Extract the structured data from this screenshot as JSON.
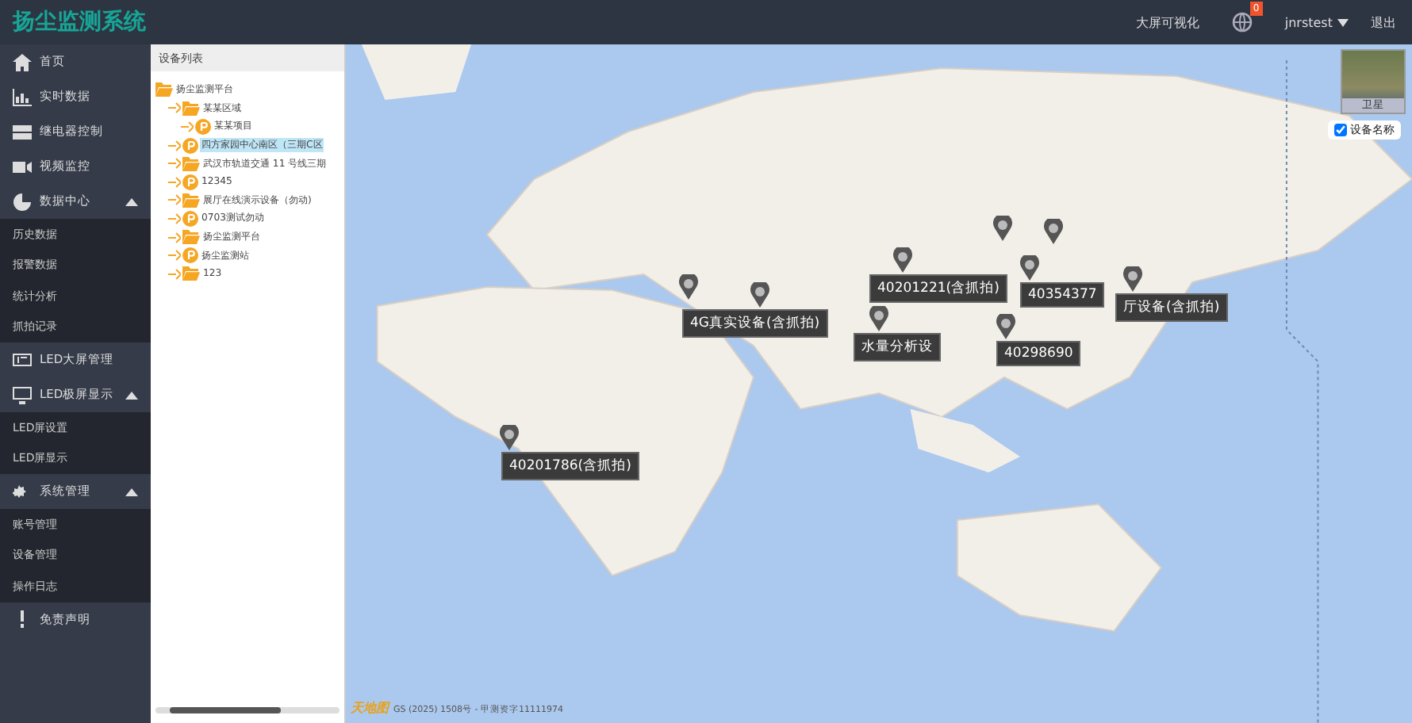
{
  "header": {
    "title": "扬尘监测系统",
    "links": [
      "大屏可视化"
    ],
    "notifications": "0",
    "user": "jnrstest",
    "logout": "退出"
  },
  "sidebar": {
    "items": [
      {
        "label": "首页",
        "selected": false
      },
      {
        "label": "实时数据",
        "selected": false
      },
      {
        "label": "继电器控制",
        "selected": false
      },
      {
        "label": "视频监控",
        "selected": false
      },
      {
        "label": "数据中心",
        "selected": false,
        "expanded": true,
        "children": [
          "历史数据",
          "报警数据",
          "统计分析",
          "抓拍记录"
        ]
      },
      {
        "label": "LED大屏管理",
        "selected": false
      },
      {
        "label": "LED极屏显示",
        "selected": false,
        "expanded": true,
        "children": [
          "LED屏设置",
          "LED屏显示"
        ]
      },
      {
        "label": "系统管理",
        "selected": false,
        "expanded": true,
        "children": [
          "账号管理",
          "设备管理",
          "操作日志"
        ]
      },
      {
        "label": "免责声明",
        "selected": false
      }
    ]
  },
  "device_panel": {
    "title": "设备列表",
    "tree": [
      {
        "kind": "folder",
        "label": "扬尘监测平台",
        "selected": false,
        "children": [
          {
            "kind": "folder",
            "label": "某某区域",
            "selected": false,
            "children": [
              {
                "kind": "device",
                "label": "某某项目",
                "selected": false
              }
            ]
          },
          {
            "kind": "device",
            "label": "四方家园中心南区（三期C区",
            "selected": true
          },
          {
            "kind": "folder",
            "label": "武汉市轨道交通 11 号线三期",
            "selected": false
          },
          {
            "kind": "device",
            "label": "12345",
            "selected": false
          },
          {
            "kind": "folder",
            "label": "展厅在线演示设备（勿动)",
            "selected": false
          },
          {
            "kind": "device",
            "label": "0703测试勿动",
            "selected": false
          },
          {
            "kind": "folder",
            "label": "扬尘监测平台",
            "selected": false
          },
          {
            "kind": "device",
            "label": "扬尘监测站",
            "selected": false
          },
          {
            "kind": "folder",
            "label": "123",
            "selected": false
          }
        ]
      }
    ]
  },
  "map": {
    "layer_switch": "卫星",
    "show_device_names": {
      "label": "设备名称",
      "checked": true
    },
    "markers": [
      {
        "label": "40201786(含抓拍)"
      },
      {
        "label": "4G真实设备(含抓拍)"
      },
      {
        "label": "40201221(含抓拍)"
      },
      {
        "label": "水量分析设"
      },
      {
        "label": "40298690"
      },
      {
        "label": "40354377"
      },
      {
        "label": "厅设备(含抓拍)"
      }
    ],
    "logo": "天地图",
    "attribution": "GS (2025) 1508号 - 甲测资字11111974"
  }
}
